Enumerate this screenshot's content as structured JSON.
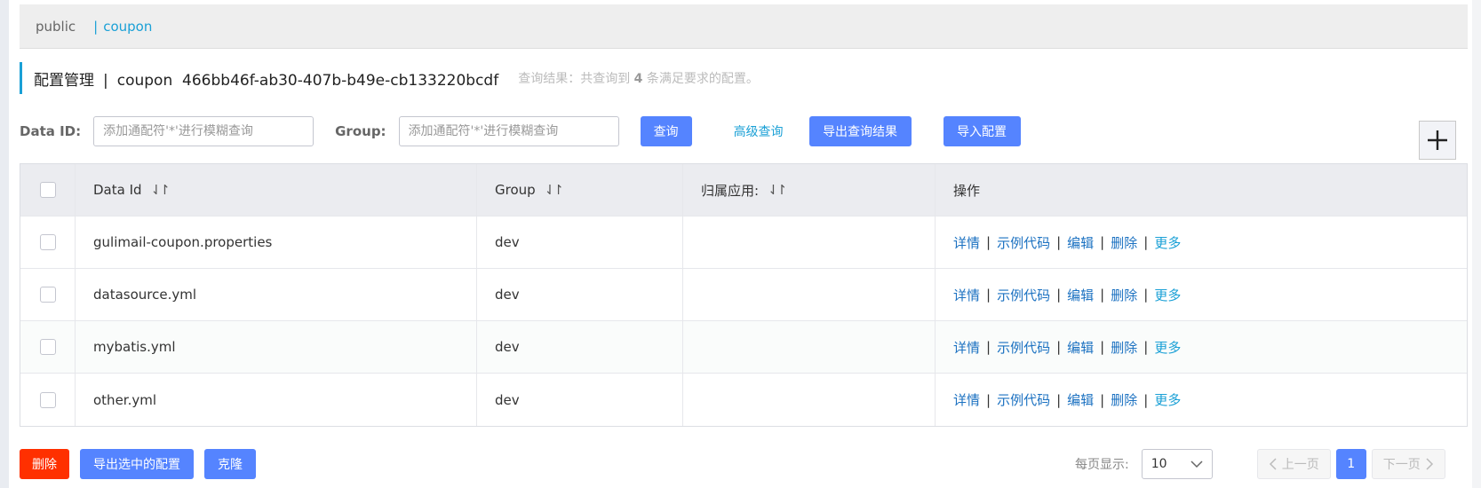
{
  "namespace_bar": {
    "public": "public",
    "separator": "|",
    "current": "coupon"
  },
  "header": {
    "title": "配置管理",
    "separator": "|",
    "namespace": "coupon",
    "namespace_id": "466bb46f-ab30-407b-b49e-cb133220bcdf",
    "result_prefix": "查询结果：共查询到",
    "result_count": "4",
    "result_suffix": "条满足要求的配置。"
  },
  "filters": {
    "data_id_label": "Data ID:",
    "data_id_placeholder": "添加通配符'*'进行模糊查询",
    "group_label": "Group:",
    "group_placeholder": "添加通配符'*'进行模糊查询",
    "query_button": "查询",
    "advanced_query": "高级查询",
    "export_results_button": "导出查询结果",
    "import_button": "导入配置"
  },
  "table": {
    "columns": [
      "Data Id",
      "Group",
      "归属应用:",
      "操作"
    ],
    "sort_icon": "⇃↾",
    "rows": [
      {
        "data_id": "gulimail-coupon.properties",
        "group": "dev",
        "app": ""
      },
      {
        "data_id": "datasource.yml",
        "group": "dev",
        "app": ""
      },
      {
        "data_id": "mybatis.yml",
        "group": "dev",
        "app": ""
      },
      {
        "data_id": "other.yml",
        "group": "dev",
        "app": ""
      }
    ],
    "ops": {
      "detail": "详情",
      "sample": "示例代码",
      "edit": "编辑",
      "delete": "删除",
      "more": "更多",
      "sep": "|"
    }
  },
  "bottom": {
    "delete_button": "删除",
    "export_selected_button": "导出选中的配置",
    "clone_button": "克隆",
    "page_size_label": "每页显示:",
    "page_size": "10",
    "prev": "上一页",
    "next": "下一页",
    "current_page": "1"
  },
  "colors": {
    "primary": "#5584ff",
    "accent": "#1aa0d6",
    "danger": "#ff3000",
    "link": "#1b71c1"
  },
  "icons": [
    "plus-icon",
    "sort-icon",
    "chevron-down-icon",
    "chevron-left-icon",
    "chevron-right-icon",
    "checkbox-icon"
  ]
}
